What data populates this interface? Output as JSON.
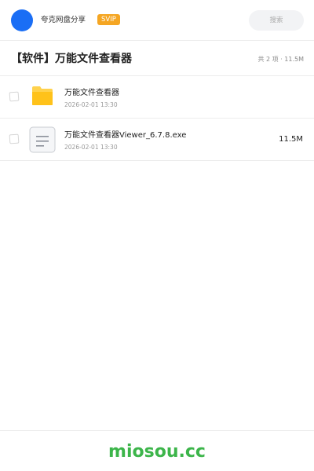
{
  "header": {
    "brand_name": "夸克网盘分享",
    "badge": "SVIP",
    "search_placeholder": "搜索"
  },
  "folder": {
    "title": "【软件】万能文件查看器",
    "summary": "共 2 项 · 11.5M"
  },
  "files": [
    {
      "type": "folder",
      "name": "万能文件查看器",
      "date": "2026-02-01 13:30",
      "size": ""
    },
    {
      "type": "file",
      "name": "万能文件查看器Viewer_6.7.8.exe",
      "date": "2026-02-01 13:30",
      "size": "11.5M"
    }
  ],
  "footer": {
    "watermark": "miosou.cc"
  },
  "colors": {
    "accent_blue": "#1a6ef5",
    "badge_orange": "#f5a623",
    "folder_yellow": "#ffc21a",
    "watermark_green": "#3cb54a"
  },
  "icons": {
    "folder": "folder-icon",
    "file": "document-icon"
  }
}
